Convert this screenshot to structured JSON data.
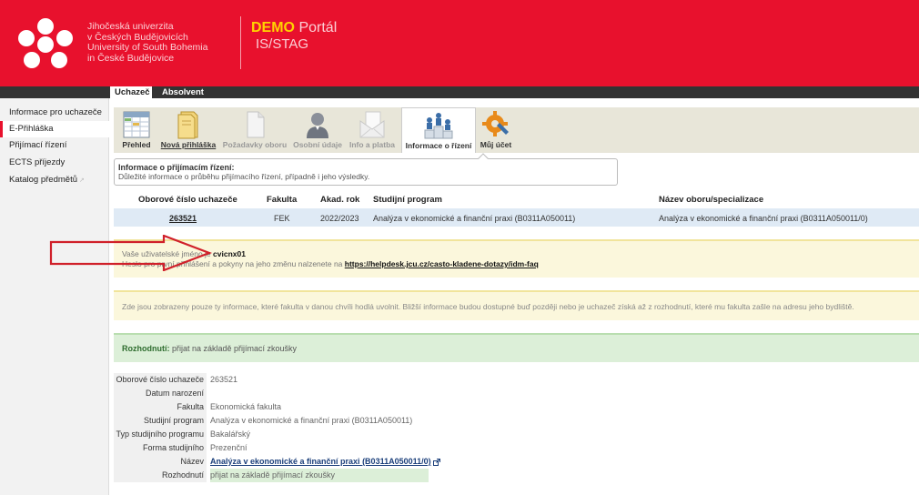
{
  "header": {
    "university_lines": [
      "Jihočeská univerzita",
      "v Českých Budějovicích",
      "University of South Bohemia",
      "in České Budějovice"
    ],
    "portal_demo": "DEMO",
    "portal_title": "Portál",
    "portal_sub": "IS/STAG",
    "brand_color": "#e8112d"
  },
  "top_tabs": [
    {
      "label": "Uchazeč",
      "active": true
    },
    {
      "label": "Absolvent",
      "active": false
    }
  ],
  "sidebar": {
    "items": [
      {
        "label": "Informace pro uchazeče",
        "active": false
      },
      {
        "label": "E-Přihláška",
        "active": true
      },
      {
        "label": "Přijímací řízení",
        "active": false
      },
      {
        "label": "ECTS příjezdy",
        "active": false
      },
      {
        "label": "Katalog předmětů",
        "active": false,
        "ext": "↗"
      }
    ]
  },
  "toolbar": {
    "items": [
      {
        "label": "Přehled",
        "icon": "table-icon"
      },
      {
        "label": "Nová přihláška",
        "icon": "folder-icon"
      },
      {
        "label": "Požadavky oboru",
        "icon": "document-icon"
      },
      {
        "label": "Osobní údaje",
        "icon": "person-icon"
      },
      {
        "label": "Info a platba",
        "icon": "envelope-icon"
      },
      {
        "label": "Informace o řízení",
        "icon": "podium-icon"
      },
      {
        "label": "Můj účet",
        "icon": "gear-wrench-icon"
      }
    ]
  },
  "infobox": {
    "title": "Informace o přijímacím řízení:",
    "text": "Důležité informace o průběhu přijímacího řízení, případně i jeho výsledky."
  },
  "main_table": {
    "headers": [
      "Oborové číslo uchazeče",
      "Fakulta",
      "Akad. rok",
      "Studijní program",
      "Název oboru/specializace"
    ],
    "row": {
      "applicant_number": "263521",
      "faculty": "FEK",
      "year": "2022/2023",
      "program": "Analýza v ekonomické a finanční praxi (B0311A050011)",
      "specialization": "Analýza v ekonomické a finanční praxi (B0311A050011/0)"
    }
  },
  "notes": {
    "username_label": "Vaše uživatelské jméno je",
    "username": "cvicnx01",
    "password_text": "Heslo pro první přihlášení a pokyny na jeho změnu nalzenete na",
    "helpdesk_url": "https://helpdesk.jcu.cz/casto-kladene-dotazy/idm-faq",
    "faculty_info": "Zde jsou zobrazeny pouze ty informace, které fakulta v danou chvíli hodlá uvolnit. Bližší informace budou dostupné buď později nebo je uchazeč získá až z rozhodnutí, které mu fakulta zašle na adresu jeho bydliště."
  },
  "decision": {
    "label": "Rozhodnutí:",
    "value": "přijat na základě přijímací zkoušky"
  },
  "detail": {
    "rows": [
      {
        "key": "Oborové číslo uchazeče",
        "value": "263521"
      },
      {
        "key": "Datum narození uchazeče",
        "value": ""
      },
      {
        "key": "Fakulta",
        "value": "Ekonomická fakulta"
      },
      {
        "key": "Studijní program",
        "value": "Analýza v ekonomické a finanční praxi (B0311A050011)"
      },
      {
        "key": "Typ studijního programu",
        "value": "Bakalářský"
      },
      {
        "key": "Forma studijního programu",
        "value": "Prezenční"
      },
      {
        "key": "Název oboru/specializace",
        "value": "Analýza v ekonomické a finanční praxi (B0311A050011/0)"
      },
      {
        "key": "Rozhodnutí",
        "value": "přijat na základě přijímací zkoušky"
      }
    ]
  }
}
